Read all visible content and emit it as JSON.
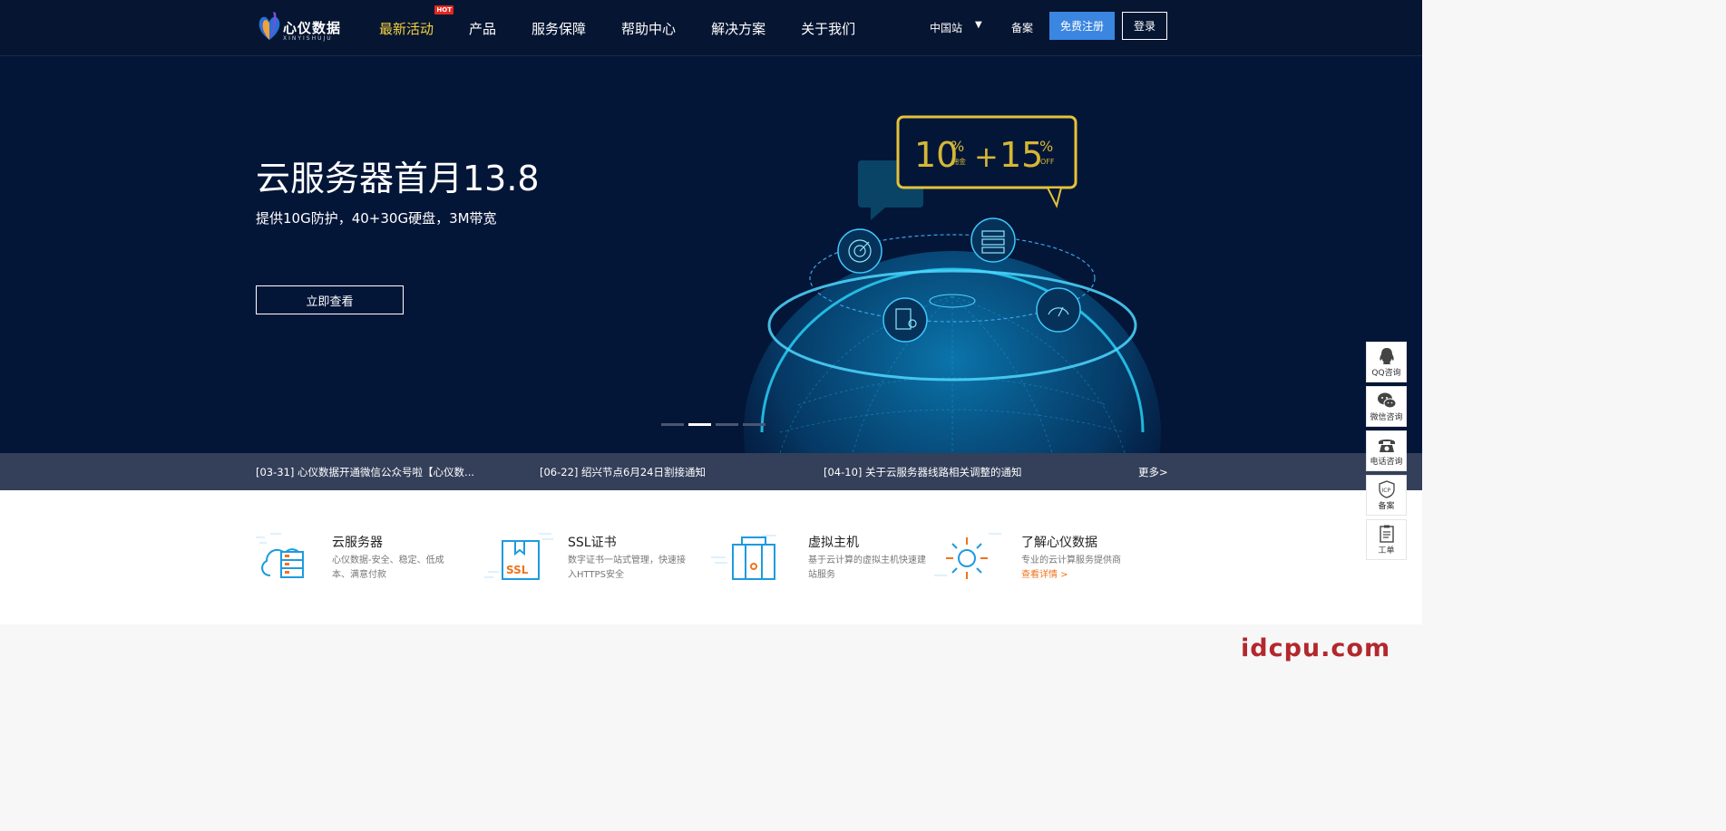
{
  "header": {
    "logo_text": "心仪数据",
    "logo_sub": "XINYISHUJU",
    "nav": [
      {
        "label": "最新活动",
        "badge": "HOT"
      },
      {
        "label": "产品"
      },
      {
        "label": "服务保障"
      },
      {
        "label": "帮助中心"
      },
      {
        "label": "解决方案"
      },
      {
        "label": "关于我们"
      }
    ],
    "region": "中国站",
    "region_arrow": "▼",
    "beian": "备案",
    "register": "免费注册",
    "login": "登录"
  },
  "hero": {
    "title": "云服务器首月13.8",
    "subtitle": "提供10G防护，40+30G硬盘，3M带宽",
    "button": "立即查看",
    "promo": {
      "a": "10",
      "a_label": "佣金",
      "plus": "+",
      "b": "15",
      "b_label": "OFF",
      "pct": "%"
    },
    "slides": 4,
    "active_slide": 1
  },
  "news": {
    "items": [
      "[03-31] 心仪数据开通微信公众号啦【心仪数...",
      "[06-22] 绍兴节点6月24日割接通知",
      "[04-10] 关于云服务器线路相关调整的通知"
    ],
    "more": "更多>"
  },
  "features": [
    {
      "title": "云服务器",
      "desc": "心仪数据-安全、稳定、低成本、满意付款",
      "icon": "cloud-server-icon"
    },
    {
      "title": "SSL证书",
      "desc": "数字证书一站式管理，快速接入HTTPS安全",
      "icon": "ssl-certificate-icon",
      "icon_text": "SSL"
    },
    {
      "title": "虚拟主机",
      "desc": "基于云计算的虚拟主机快速建站服务",
      "icon": "virtual-host-icon"
    },
    {
      "title": "了解心仪数据",
      "desc": "专业的云计算服务提供商",
      "link": "查看详情 >",
      "icon": "sun-gear-icon"
    }
  ],
  "side_tools": [
    {
      "label": "QQ咨询",
      "icon": "qq-icon"
    },
    {
      "label": "微信咨询",
      "icon": "wechat-icon"
    },
    {
      "label": "电话咨询",
      "icon": "phone-icon"
    },
    {
      "label": "备案",
      "icon": "icp-icon",
      "icon_text": "ICP"
    },
    {
      "label": "工单",
      "icon": "ticket-icon"
    }
  ],
  "watermark": "idcpu.com",
  "colors": {
    "header_bg": "#061532",
    "hero_bg": "#041638",
    "accent_blue": "#3b86e0",
    "nav_active": "#f2d23a",
    "link_orange": "#f0731d",
    "hot_red": "#e3271f"
  }
}
